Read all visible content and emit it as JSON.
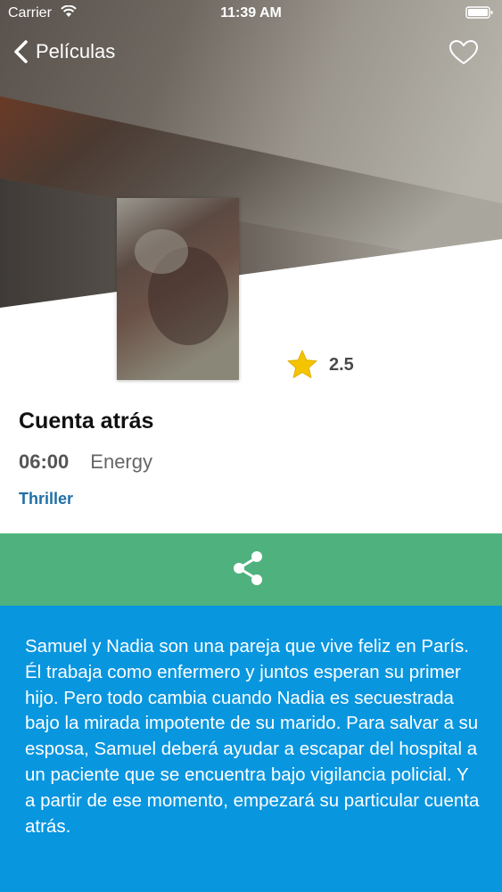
{
  "status_bar": {
    "carrier": "Carrier",
    "time": "11:39 AM",
    "icons": [
      "wifi-icon",
      "battery-icon"
    ]
  },
  "nav": {
    "back_label": "Películas",
    "back_icon": "chevron-left-icon",
    "favorite_icon": "heart-icon"
  },
  "movie": {
    "rating": "2.5",
    "rating_icon": "star-icon",
    "title": "Cuenta atrás",
    "showtime": "06:00",
    "channel": "Energy",
    "genre": "Thriller"
  },
  "share": {
    "icon": "share-icon"
  },
  "synopsis": {
    "text": "Samuel y Nadia son una pareja que vive feliz en París. Él trabaja como enfermero y juntos esperan su primer hijo. Pero todo cambia cuando Nadia es secuestrada bajo la mirada impotente de su marido. Para salvar a su esposa, Samuel deberá ayudar a escapar del hospital a un paciente que se encuentra bajo vigilancia policial. Y a partir de ese momento, empezará su particular cuenta atrás."
  },
  "colors": {
    "share_bar": "#4fb27e",
    "synopsis_bg": "#0896df",
    "genre_text": "#1f6fa6",
    "star": "#f5c400"
  }
}
